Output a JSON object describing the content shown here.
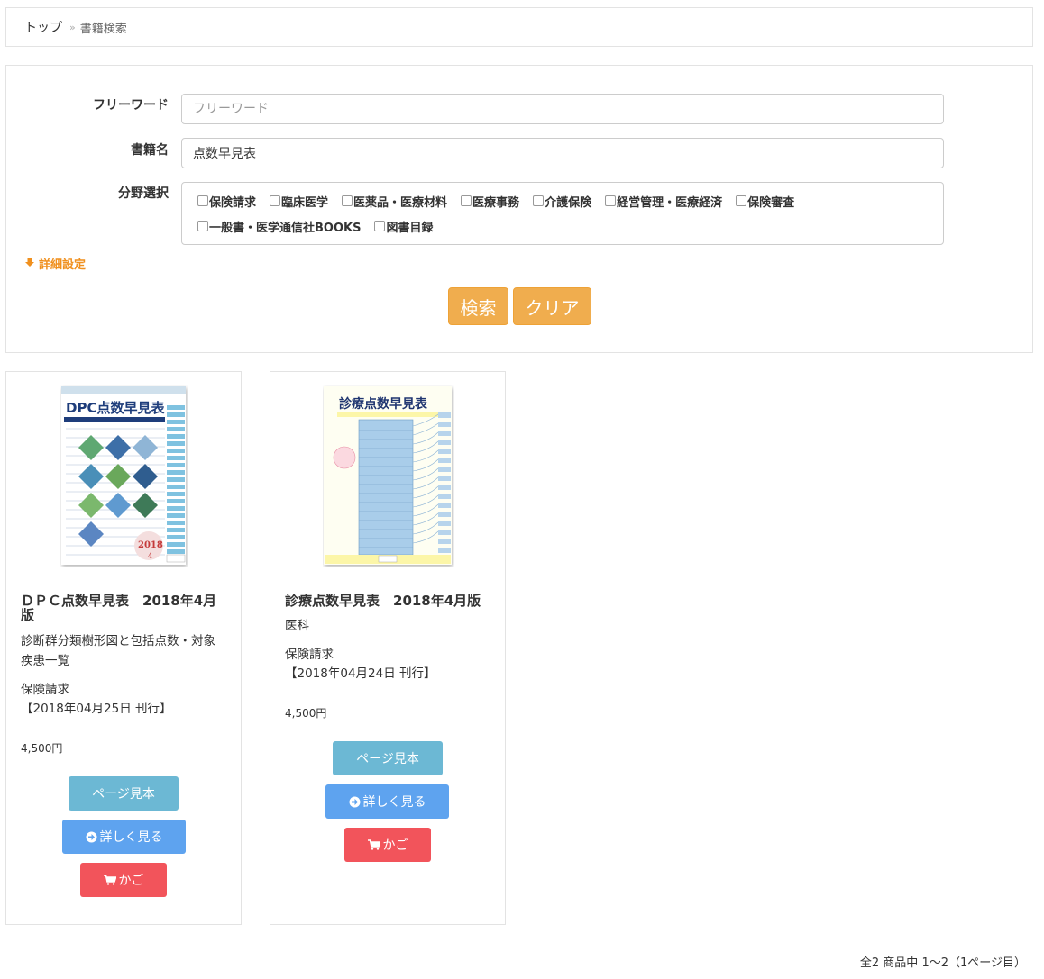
{
  "breadcrumb": {
    "top": "トップ",
    "separator": "»",
    "current": "書籍検索"
  },
  "search": {
    "freeword_label": "フリーワード",
    "freeword_placeholder": "フリーワード",
    "freeword_value": "",
    "bookname_label": "書籍名",
    "bookname_value": "点数早見表",
    "category_label": "分野選択",
    "categories": [
      {
        "label": "保険請求",
        "checked": false
      },
      {
        "label": "臨床医学",
        "checked": false
      },
      {
        "label": "医薬品・医療材料",
        "checked": false
      },
      {
        "label": "医療事務",
        "checked": false
      },
      {
        "label": "介護保険",
        "checked": false
      },
      {
        "label": "経営管理・医療経済",
        "checked": false
      },
      {
        "label": "保険審査",
        "checked": false
      },
      {
        "label": "一般書・医学通信社BOOKS",
        "checked": false
      },
      {
        "label": "図書目録",
        "checked": false
      }
    ],
    "detail_label": "詳細設定",
    "search_button": "検索",
    "clear_button": "クリア"
  },
  "products": [
    {
      "title_line1": "ＤＰＣ点数早見表　2018年4月",
      "title_line2": "版",
      "subtitle_line1": "診断群分類樹形図と包括点数・対象",
      "subtitle_line2": "疾患一覧",
      "field": "保険請求",
      "published": "【2018年04月25日 刊行】",
      "price": "4,500円",
      "cover": {
        "title": "DPC点数早見表",
        "year": "2018",
        "month": "4"
      },
      "sample_button": "ページ見本",
      "detail_button": "詳しく見る",
      "cart_button": "かご"
    },
    {
      "title": "診療点数早見表　2018年4月版",
      "subtitle": "医科",
      "field": "保険請求",
      "published": "【2018年04月24日 刊行】",
      "price": "4,500円",
      "cover": {
        "title": "診療点数早見表"
      },
      "sample_button": "ページ見本",
      "detail_button": "詳しく見る",
      "cart_button": "かご"
    }
  ],
  "pagination": {
    "summary": "全2 商品中 1～2（1ページ目）"
  },
  "colors": {
    "accent_orange": "#f0ad4e",
    "sample_blue": "#6cb8d4",
    "detail_blue": "#5ea3ef",
    "cart_red": "#f2545b",
    "detail_link": "#f0901e"
  }
}
